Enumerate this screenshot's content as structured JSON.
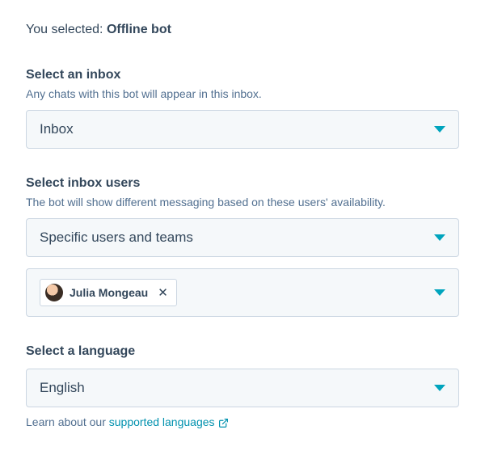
{
  "header": {
    "selected_prefix": "You selected: ",
    "selected_value": "Offline bot"
  },
  "inbox": {
    "title": "Select an inbox",
    "help": "Any chats with this bot will appear in this inbox.",
    "value": "Inbox"
  },
  "users": {
    "title": "Select inbox users",
    "help": "The bot will show different messaging based on these users' availability.",
    "mode_value": "Specific users and teams",
    "chips": [
      {
        "name": "Julia Mongeau"
      }
    ]
  },
  "language": {
    "title": "Select a language",
    "value": "English",
    "help_prefix": "Learn about our ",
    "help_link": "supported languages"
  }
}
